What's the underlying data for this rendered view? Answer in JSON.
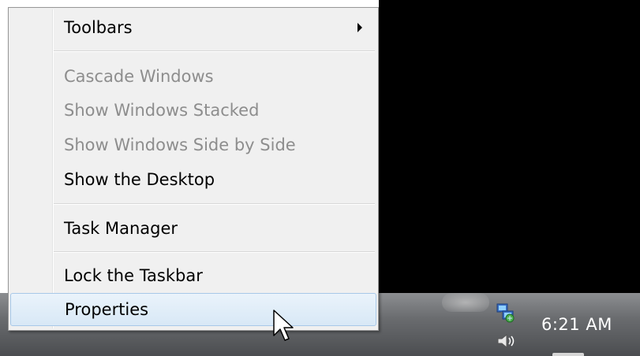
{
  "context_menu": {
    "items": [
      {
        "label": "Toolbars",
        "enabled": true,
        "has_submenu": true
      },
      {
        "label": "Cascade Windows",
        "enabled": false
      },
      {
        "label": "Show Windows Stacked",
        "enabled": false
      },
      {
        "label": "Show Windows Side by Side",
        "enabled": false
      },
      {
        "label": "Show the Desktop",
        "enabled": true
      },
      {
        "label": "Task Manager",
        "enabled": true
      },
      {
        "label": "Lock the Taskbar",
        "enabled": true
      },
      {
        "label": "Properties",
        "enabled": true,
        "highlighted": true
      }
    ]
  },
  "tray": {
    "clock": "6:21 AM",
    "icons": [
      "network-icon",
      "volume-icon"
    ]
  },
  "colors": {
    "menu_bg": "#f0f0f0",
    "disabled_text": "#8d8d8d",
    "highlight_border": "#a8c8e8",
    "desktop_bg": "#000000"
  }
}
